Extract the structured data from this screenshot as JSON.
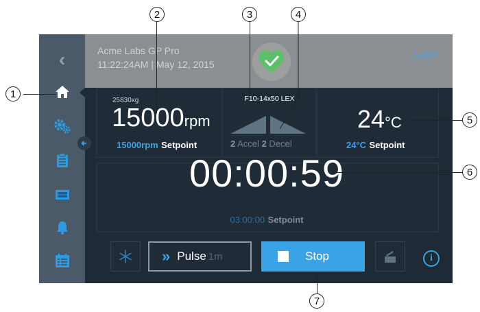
{
  "header": {
    "device_name": "Acme Labs GP Pro",
    "datetime": "11:22:24AM | May 12, 2015",
    "login_label": "Login",
    "status_icon": "heart-check-icon"
  },
  "sidebar": {
    "items": [
      {
        "name": "back",
        "icon": "chevron-left-icon"
      },
      {
        "name": "home",
        "icon": "home-icon"
      },
      {
        "name": "settings",
        "icon": "gears-icon"
      },
      {
        "name": "programs",
        "icon": "clipboard-icon"
      },
      {
        "name": "rotor",
        "icon": "film-icon"
      },
      {
        "name": "alarms",
        "icon": "bell-icon"
      },
      {
        "name": "log",
        "icon": "calendar-list-icon"
      }
    ]
  },
  "speed": {
    "rcf": "25830xg",
    "value": "15000",
    "unit": "rpm",
    "setpoint_value": "15000rpm",
    "setpoint_label": "Setpoint"
  },
  "rotor": {
    "name": "F10-14x50 LEX",
    "accel_num": "2",
    "accel_label": "Accel",
    "decel_num": "2",
    "decel_label": "Decel"
  },
  "temperature": {
    "value": "24",
    "unit": "°C",
    "setpoint_value": "24°C",
    "setpoint_label": "Setpoint"
  },
  "timer": {
    "value": "00:00:59",
    "setpoint_value": "03:00:00",
    "setpoint_label": "Setpoint"
  },
  "controls": {
    "pulse_label": "Pulse",
    "pulse_sub": "1m",
    "stop_label": "Stop"
  },
  "callouts": [
    "1",
    "2",
    "3",
    "4",
    "5",
    "6",
    "7"
  ],
  "colors": {
    "screen_bg": "#1e2b36",
    "sidebar_bg": "#4a5a68",
    "accent_blue": "#3aa3e5",
    "header_overlay": "#8a8f93",
    "heart_green": "#5cbf6a"
  }
}
